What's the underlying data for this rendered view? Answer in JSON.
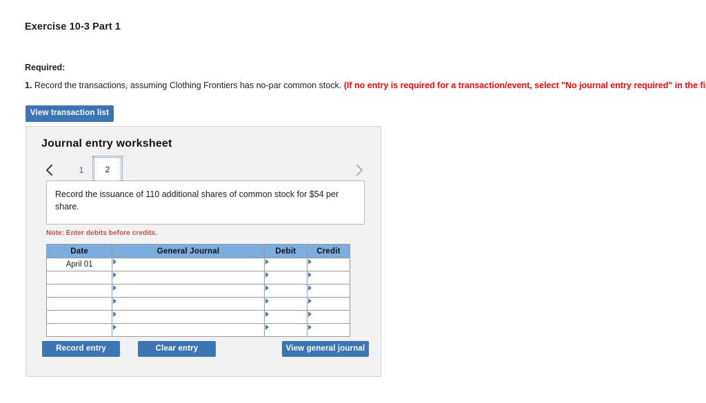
{
  "page": {
    "exercise_title": "Exercise 10-3 Part 1",
    "required_label": "Required:",
    "requirement": {
      "number": "1.",
      "text": " Record the transactions, assuming Clothing Frontiers has no-par common stock. ",
      "note": "(If no entry is required for a transaction/event, select \"No journal entry required\" in the first account field.)"
    },
    "view_transaction_list_label": "View transaction list"
  },
  "worksheet": {
    "title": "Journal entry worksheet",
    "pager": {
      "prev_icon": "chevron-left-icon",
      "next_icon": "chevron-right-icon",
      "pages": [
        {
          "label": "1",
          "active": false
        },
        {
          "label": "2",
          "active": true
        }
      ]
    },
    "transaction_description": "Record the issuance of 110 additional shares of common stock for $54 per share.",
    "note": "Note: Enter debits before credits.",
    "table": {
      "columns": [
        "Date",
        "General Journal",
        "Debit",
        "Credit"
      ],
      "rows": [
        {
          "date": "April 01",
          "general_journal": "",
          "debit": "",
          "credit": ""
        },
        {
          "date": "",
          "general_journal": "",
          "debit": "",
          "credit": ""
        },
        {
          "date": "",
          "general_journal": "",
          "debit": "",
          "credit": ""
        },
        {
          "date": "",
          "general_journal": "",
          "debit": "",
          "credit": ""
        },
        {
          "date": "",
          "general_journal": "",
          "debit": "",
          "credit": ""
        },
        {
          "date": "",
          "general_journal": "",
          "debit": "",
          "credit": ""
        }
      ]
    },
    "buttons": {
      "record_entry": "Record entry",
      "clear_entry": "Clear entry",
      "view_general_journal": "View general journal"
    }
  },
  "colors": {
    "button_blue": "#3d74b4",
    "table_header_blue": "#7badde",
    "note_red": "#c1504d",
    "requirement_red": "#fb0707",
    "panel_gray": "#f2f2f2",
    "marker_blue": "#4a7ebb"
  }
}
